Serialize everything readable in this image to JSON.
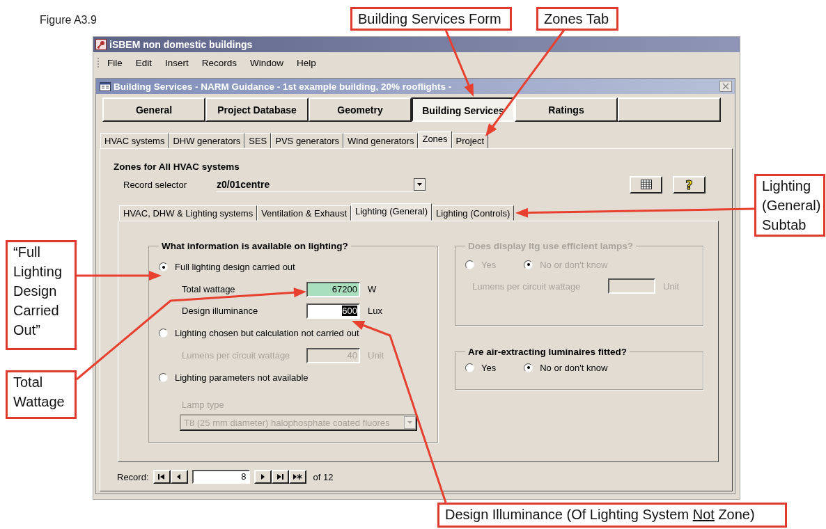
{
  "figure_label": "Figure A3.9",
  "app": {
    "title": "iSBEM non domestic buildings",
    "menu": [
      "File",
      "Edit",
      "Insert",
      "Records",
      "Window",
      "Help"
    ]
  },
  "form": {
    "title": "Building Services - NARM Guidance - 1st example building, 20% rooflights -",
    "main_tabs": [
      {
        "label": "General",
        "selected": false
      },
      {
        "label": "Project Database",
        "selected": false
      },
      {
        "label": "Geometry",
        "selected": false
      },
      {
        "label": "Building Services",
        "selected": true
      },
      {
        "label": "Ratings",
        "selected": false
      }
    ],
    "sub_tabs": [
      {
        "label": "HVAC systems",
        "selected": false
      },
      {
        "label": "DHW generators",
        "selected": false
      },
      {
        "label": "SES",
        "selected": false
      },
      {
        "label": "PVS generators",
        "selected": false
      },
      {
        "label": "Wind generators",
        "selected": false
      },
      {
        "label": "Zones",
        "selected": true
      },
      {
        "label": "Project",
        "selected": false
      }
    ],
    "heading": "Zones for All HVAC systems",
    "record_selector": {
      "label": "Record selector",
      "value": "z0/01centre"
    },
    "help_symbol": "?",
    "inner_tabs": [
      {
        "label": "HVAC, DHW & Lighting systems",
        "selected": false
      },
      {
        "label": "Ventilation & Exhaust",
        "selected": false
      },
      {
        "label": "Lighting (General)",
        "selected": true
      },
      {
        "label": "Lighting (Controls)",
        "selected": false
      }
    ],
    "lighting_group": {
      "title": "What information is available on lighting?",
      "rows": [
        {
          "kind": "radio",
          "label": "Full lighting design carried out",
          "selected": true
        },
        {
          "kind": "field",
          "label": "Total wattage",
          "value": "67200",
          "unit": "W",
          "disabled": false,
          "highlighted": true,
          "text_selected": false
        },
        {
          "kind": "field",
          "label": "Design illuminance",
          "value": "600",
          "unit": "Lux",
          "disabled": false,
          "highlighted": false,
          "text_selected": true
        },
        {
          "kind": "radio",
          "label": "Lighting chosen but calculation not carried out",
          "selected": false
        },
        {
          "kind": "field",
          "label": "Lumens per circuit wattage",
          "value": "40",
          "unit": "Unit",
          "disabled": true,
          "highlighted": false,
          "text_selected": false
        },
        {
          "kind": "radio",
          "label": "Lighting parameters not available",
          "selected": false
        },
        {
          "kind": "select",
          "label": "Lamp type",
          "value": "T8 (25 mm diameter) halophosphate coated fluores",
          "disabled": true
        }
      ]
    },
    "display_group": {
      "title": "Does display ltg use efficient lamps?",
      "disabled": true,
      "options": [
        {
          "label": "Yes",
          "selected": false
        },
        {
          "label": "No or don't know",
          "selected": true
        }
      ],
      "field": {
        "label": "Lumens per circuit wattage",
        "unit": "Unit"
      }
    },
    "air_group": {
      "title": "Are air-extracting luminaires fitted?",
      "disabled": false,
      "options": [
        {
          "label": "Yes",
          "selected": false
        },
        {
          "label": "No or don't know",
          "selected": true
        }
      ]
    },
    "record_nav": {
      "label": "Record:",
      "current": "8",
      "total": "of 12"
    }
  },
  "annotations": [
    {
      "parts": [
        {
          "text": "Building Services Form",
          "underline": false
        }
      ]
    },
    {
      "parts": [
        {
          "text": "Zones Tab",
          "underline": false
        }
      ]
    },
    {
      "parts": [
        {
          "text": "Lighting (General) Subtab",
          "underline": false
        }
      ]
    },
    {
      "parts": [
        {
          "text": "“Full Lighting Design Carried Out”",
          "underline": false
        }
      ]
    },
    {
      "parts": [
        {
          "text": "Total Wattage",
          "underline": false
        }
      ]
    },
    {
      "parts": [
        {
          "text": "Design Illuminance (Of Lighting System ",
          "underline": false
        },
        {
          "text": "Not",
          "underline": true
        },
        {
          "text": " Zone)",
          "underline": false
        }
      ]
    }
  ]
}
